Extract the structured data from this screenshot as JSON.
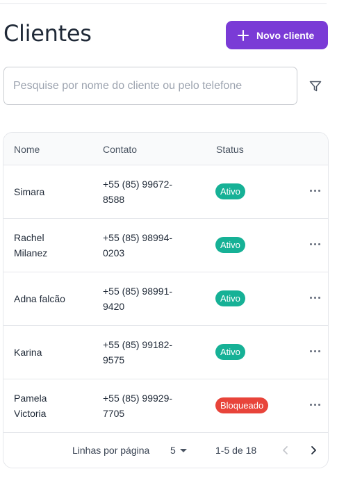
{
  "header": {
    "title": "Clientes",
    "new_button_label": "Novo cliente",
    "new_button_icon": "plus-icon"
  },
  "search": {
    "placeholder": "Pesquise por nome do cliente ou pelo telefone",
    "value": "",
    "filter_icon": "filter-icon"
  },
  "table": {
    "columns": [
      "Nome",
      "Contato",
      "Status"
    ],
    "rows": [
      {
        "name_lines": [
          "Simara"
        ],
        "contact_lines": [
          "+55 (85) 99672-",
          "8588"
        ],
        "status": "Ativo",
        "status_type": "active"
      },
      {
        "name_lines": [
          "Rachel",
          "Milanez"
        ],
        "contact_lines": [
          "+55 (85) 98994-",
          "0203"
        ],
        "status": "Ativo",
        "status_type": "active"
      },
      {
        "name_lines": [
          "Adna falcão"
        ],
        "contact_lines": [
          "+55 (85) 98991-",
          "9420"
        ],
        "status": "Ativo",
        "status_type": "active"
      },
      {
        "name_lines": [
          "Karina"
        ],
        "contact_lines": [
          "+55 (85) 99182-",
          "9575"
        ],
        "status": "Ativo",
        "status_type": "active"
      },
      {
        "name_lines": [
          "Pamela",
          "Victoria"
        ],
        "contact_lines": [
          "+55 (85) 99929-",
          "7705"
        ],
        "status": "Bloqueado",
        "status_type": "blocked"
      }
    ],
    "row_action_icon": "more-horizontal-icon"
  },
  "pagination": {
    "rows_per_page_label": "Linhas por página",
    "rows_per_page_value": "5",
    "range_text": "1-5 de 18",
    "prev_icon": "chevron-left-icon",
    "next_icon": "chevron-right-icon"
  },
  "colors": {
    "accent": "#7a3bd6",
    "active": "#16b196",
    "blocked": "#e8443a"
  }
}
